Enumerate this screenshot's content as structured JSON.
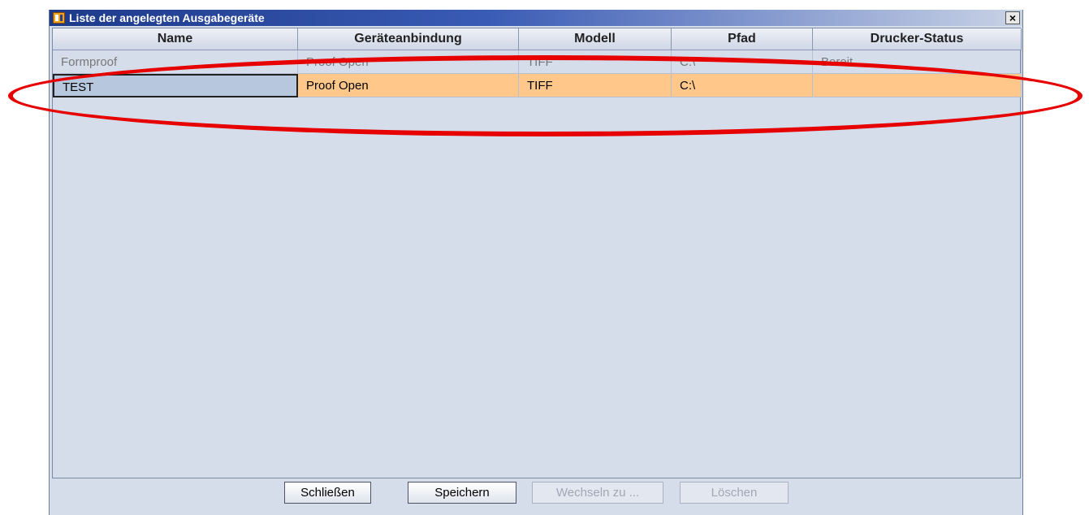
{
  "window": {
    "title": "Liste der angelegten Ausgabegeräte",
    "close_label": "×"
  },
  "table": {
    "columns": [
      "Name",
      "Geräteanbindung",
      "Modell",
      "Pfad",
      "Drucker-Status"
    ],
    "rows": [
      [
        "Formproof",
        "Proof Open",
        "TIFF",
        "C:\\",
        "Bereit"
      ],
      [
        "TEST",
        "Proof Open",
        "TIFF",
        "C:\\",
        ""
      ]
    ],
    "selected_row": 1
  },
  "buttons": {
    "close": "Schließen",
    "save": "Speichern",
    "switch": "Wechseln zu ...",
    "delete": "Löschen"
  },
  "colors": {
    "selection": "#ffc88a",
    "annotation": "#e60000",
    "background": "#d5ddeb"
  },
  "icons": {
    "app": "app-logo-icon",
    "close": "close-icon"
  }
}
